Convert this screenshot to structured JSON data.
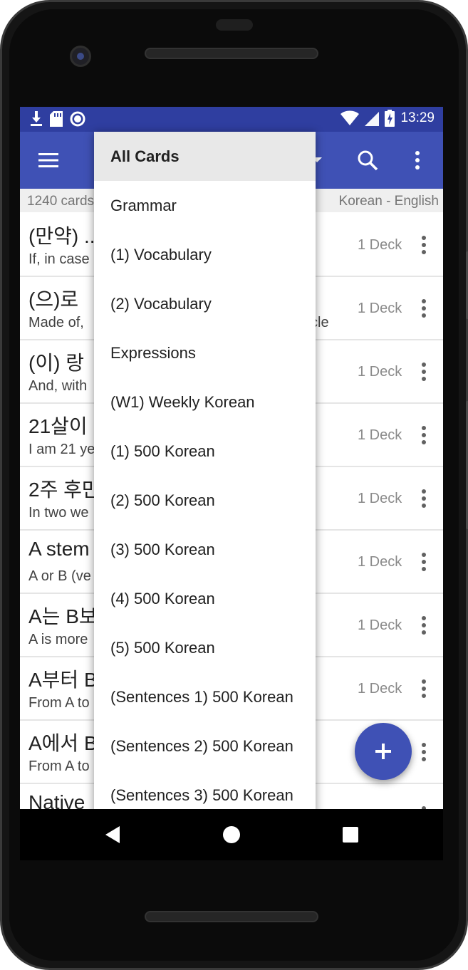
{
  "status_bar": {
    "time": "13:29",
    "icons": [
      "download-icon",
      "sd-card-icon",
      "circle-icon",
      "wifi-icon",
      "signal-icon",
      "battery-charging-icon"
    ]
  },
  "app_bar": {
    "menu_icon": "hamburger-menu-icon",
    "search_icon": "search-icon",
    "more_icon": "more-vert-icon",
    "dropdown_icon": "triangle-down-icon",
    "color": "#3f51b5",
    "status_color": "#2f3ea0"
  },
  "subheader": {
    "count": "1240 cards",
    "language": "Korean - English"
  },
  "cards": [
    {
      "front": "(만약) ...",
      "back": "If, in case",
      "deck": "1 Deck"
    },
    {
      "front": "(으)로",
      "back": "Made of,",
      "back_tail": "cle",
      "deck": "1 Deck"
    },
    {
      "front": "(이) 랑",
      "back": "And, with",
      "deck": "1 Deck"
    },
    {
      "front": "21살이",
      "back": "I am 21 ye",
      "deck": "1 Deck"
    },
    {
      "front": "2주 후만",
      "back": "In two we",
      "deck": "1 Deck"
    },
    {
      "front": "A stem",
      "back": "A or B (ve",
      "deck": "1 Deck"
    },
    {
      "front": "A는 B보",
      "back": "A is more",
      "deck": "1 Deck"
    },
    {
      "front": "A부터 B",
      "back": "From A to",
      "deck": "1 Deck"
    },
    {
      "front": "A에서 B",
      "back": "From A to",
      "deck": ""
    },
    {
      "front": "Native",
      "back": "",
      "deck": ""
    }
  ],
  "dropdown": {
    "items": [
      "All Cards",
      "Grammar",
      "(1) Vocabulary",
      "(2) Vocabulary",
      "Expressions",
      "(W1) Weekly Korean",
      "(1) 500 Korean",
      "(2) 500 Korean",
      "(3) 500 Korean",
      "(4) 500 Korean",
      "(5) 500 Korean",
      "(Sentences 1) 500 Korean",
      "(Sentences 2) 500 Korean",
      "(Sentences 3) 500 Korean"
    ],
    "selected_index": 0
  },
  "fab": {
    "icon": "plus-icon",
    "color": "#3f51b5"
  },
  "nav_bar": {
    "icons": [
      "back-triangle-icon",
      "home-circle-icon",
      "recents-square-icon"
    ]
  }
}
